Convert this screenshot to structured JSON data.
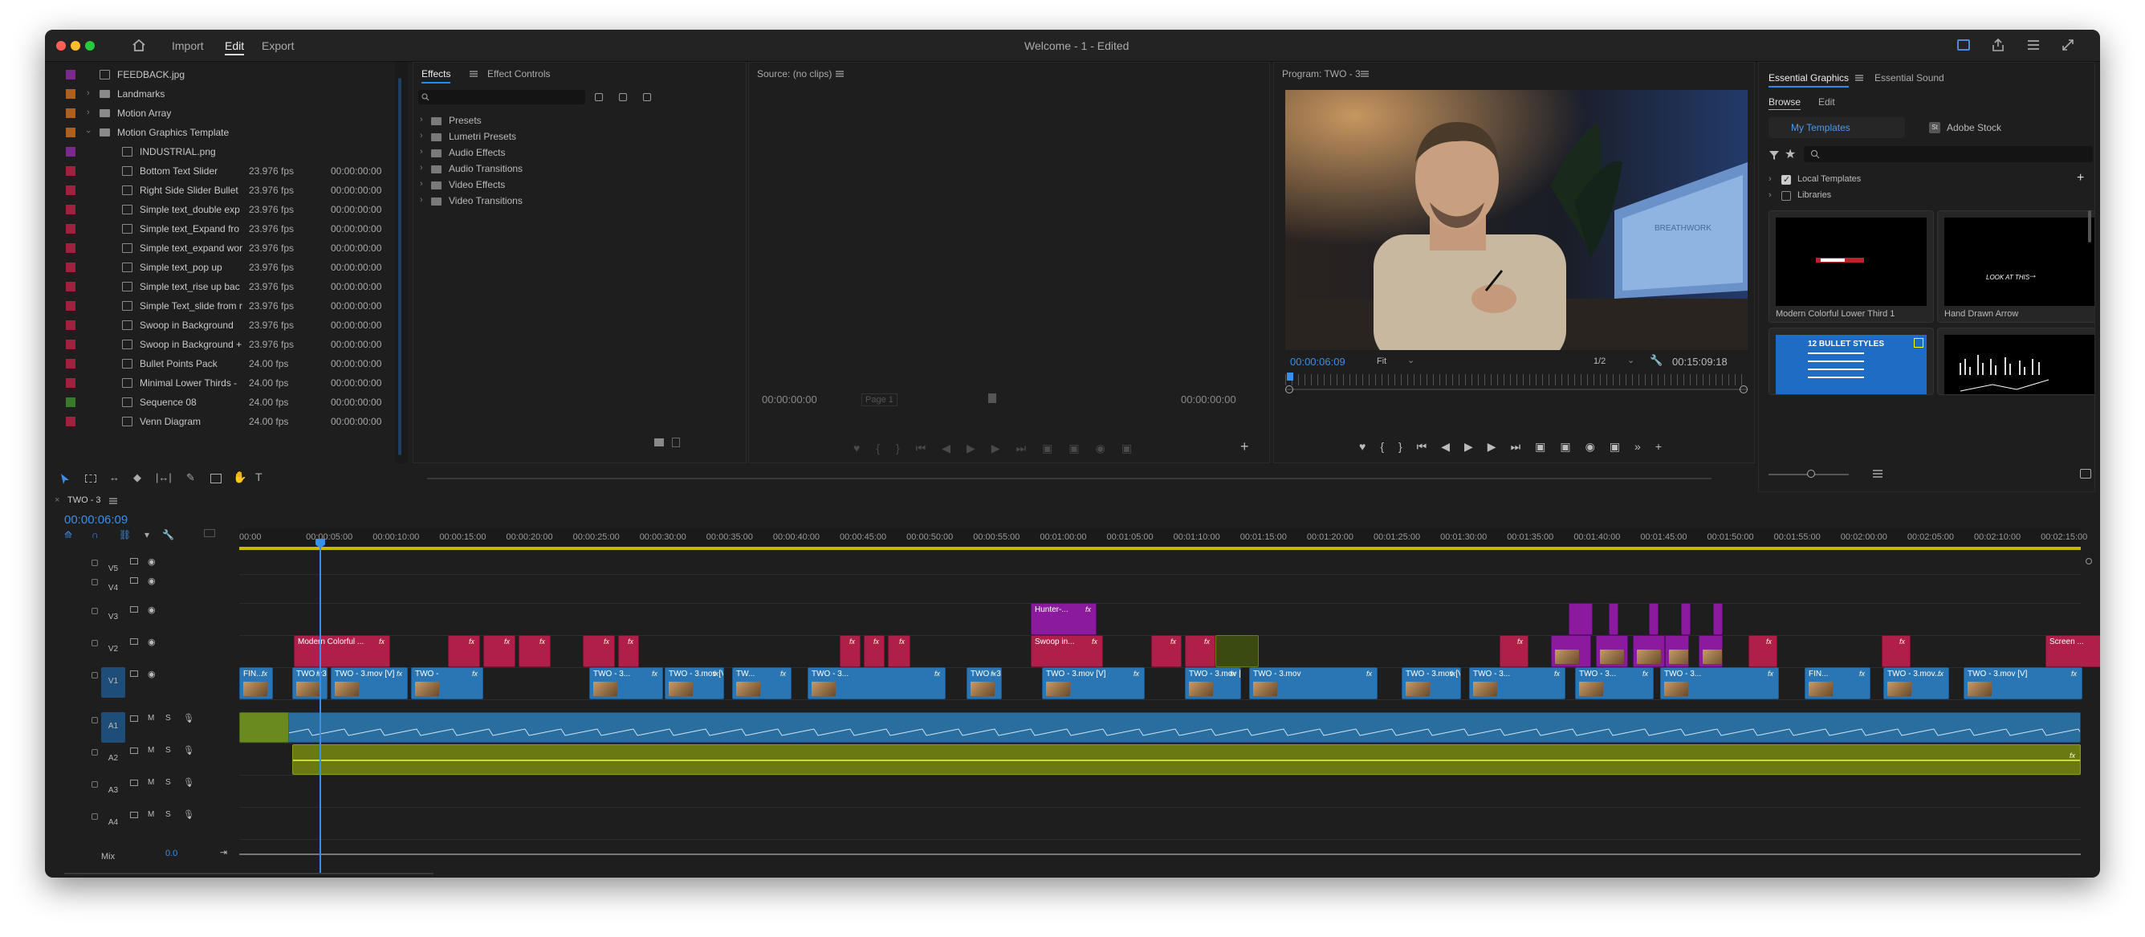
{
  "window": {
    "title": "Welcome - 1 - Edited",
    "menu": [
      "Import",
      "Edit",
      "Export"
    ],
    "active_menu": "Edit"
  },
  "project": {
    "items": [
      {
        "name": "FEEDBACK.jpg",
        "kind": "image",
        "color": "#7a2a8e",
        "fps": "",
        "start": "",
        "indent": 1
      },
      {
        "name": "Landmarks",
        "kind": "folder",
        "color": "#b0601e",
        "fps": "",
        "start": "",
        "indent": 1
      },
      {
        "name": "Motion Array",
        "kind": "folder",
        "color": "#b0601e",
        "fps": "",
        "start": "",
        "indent": 1
      },
      {
        "name": "Motion Graphics Template",
        "kind": "folder",
        "color": "#b0601e",
        "fps": "",
        "start": "",
        "indent": 1,
        "open": true
      },
      {
        "name": "INDUSTRIAL.png",
        "kind": "image",
        "color": "#7a2a8e",
        "fps": "",
        "start": "",
        "indent": 2
      },
      {
        "name": "Bottom Text Slider",
        "kind": "mogrt",
        "color": "#a02040",
        "fps": "23.976 fps",
        "start": "00:00:00:00",
        "indent": 2
      },
      {
        "name": "Right Side Slider Bullet",
        "kind": "mogrt",
        "color": "#a02040",
        "fps": "23.976 fps",
        "start": "00:00:00:00",
        "indent": 2
      },
      {
        "name": "Simple text_double exp",
        "kind": "mogrt",
        "color": "#a02040",
        "fps": "23.976 fps",
        "start": "00:00:00:00",
        "indent": 2
      },
      {
        "name": "Simple text_Expand fro",
        "kind": "mogrt",
        "color": "#a02040",
        "fps": "23.976 fps",
        "start": "00:00:00:00",
        "indent": 2
      },
      {
        "name": "Simple text_expand wor",
        "kind": "mogrt",
        "color": "#a02040",
        "fps": "23.976 fps",
        "start": "00:00:00:00",
        "indent": 2
      },
      {
        "name": "Simple text_pop up",
        "kind": "mogrt",
        "color": "#a02040",
        "fps": "23.976 fps",
        "start": "00:00:00:00",
        "indent": 2
      },
      {
        "name": "Simple text_rise up bac",
        "kind": "mogrt",
        "color": "#a02040",
        "fps": "23.976 fps",
        "start": "00:00:00:00",
        "indent": 2
      },
      {
        "name": "Simple Text_slide from r",
        "kind": "mogrt",
        "color": "#a02040",
        "fps": "23.976 fps",
        "start": "00:00:00:00",
        "indent": 2
      },
      {
        "name": "Swoop in Background",
        "kind": "mogrt",
        "color": "#a02040",
        "fps": "23.976 fps",
        "start": "00:00:00:00",
        "indent": 2
      },
      {
        "name": "Swoop in Background +",
        "kind": "mogrt",
        "color": "#a02040",
        "fps": "23.976 fps",
        "start": "00:00:00:00",
        "indent": 2
      },
      {
        "name": "Bullet Points Pack",
        "kind": "mogrt",
        "color": "#a02040",
        "fps": "24.00 fps",
        "start": "00:00:00:00",
        "indent": 2
      },
      {
        "name": "Minimal Lower Thirds -",
        "kind": "mogrt",
        "color": "#a02040",
        "fps": "24.00 fps",
        "start": "00:00:00:00",
        "indent": 2
      },
      {
        "name": "Sequence 08",
        "kind": "sequence",
        "color": "#3a7a2a",
        "fps": "24.00 fps",
        "start": "00:00:00:00",
        "indent": 2
      },
      {
        "name": "Venn Diagram",
        "kind": "mogrt",
        "color": "#a02040",
        "fps": "24.00 fps",
        "start": "00:00:00:00",
        "indent": 2
      }
    ]
  },
  "effects": {
    "tabs": [
      "Effects",
      "Effect Controls"
    ],
    "active_tab": "Effects",
    "folders": [
      "Presets",
      "Lumetri Presets",
      "Audio Effects",
      "Audio Transitions",
      "Video Effects",
      "Video Transitions"
    ]
  },
  "source": {
    "title": "Source: (no clips)",
    "timecode_left": "00:00:00:00",
    "timecode_right": "00:00:00:00",
    "page": "Page 1"
  },
  "program": {
    "title": "Program: TWO - 3",
    "timecode": "00:00:06:09",
    "fit": "Fit",
    "resolution": "1/2",
    "duration": "00:15:09:18",
    "frame_text": "BREATHWORK"
  },
  "essential_graphics": {
    "tabs": [
      "Essential Graphics",
      "Essential Sound"
    ],
    "subtabs": [
      "Browse",
      "Edit"
    ],
    "sources": [
      "My Templates",
      "Adobe Stock"
    ],
    "tree": [
      "Local Templates",
      "Libraries"
    ],
    "templates": [
      {
        "name": "Modern Colorful Lower Third 1"
      },
      {
        "name": "Hand Drawn Arrow",
        "thumb_text": "LOOK AT THIS"
      },
      {
        "name": "",
        "thumb_text": "12 BULLET STYLES"
      },
      {
        "name": ""
      }
    ]
  },
  "timeline": {
    "sequence": "TWO - 3",
    "timecode": "00:00:06:09",
    "ruler": [
      "00:00",
      "00:00:05:00",
      "00:00:10:00",
      "00:00:15:00",
      "00:00:20:00",
      "00:00:25:00",
      "00:00:30:00",
      "00:00:35:00",
      "00:00:40:00",
      "00:00:45:00",
      "00:00:50:00",
      "00:00:55:00",
      "00:01:00:00",
      "00:01:05:00",
      "00:01:10:00",
      "00:01:15:00",
      "00:01:20:00",
      "00:01:25:00",
      "00:01:30:00",
      "00:01:35:00",
      "00:01:40:00",
      "00:01:45:00",
      "00:01:50:00",
      "00:01:55:00",
      "00:02:00:00",
      "00:02:05:00",
      "00:02:10:00",
      "00:02:15:00"
    ],
    "video_tracks": [
      "V5",
      "V4",
      "V3",
      "V2",
      "V1"
    ],
    "audio_tracks": [
      "A1",
      "A2",
      "A3",
      "A4"
    ],
    "mix_label": "Mix",
    "mix_value": "0.0",
    "clips_v1": [
      "FIN...",
      "TWO - 3.mov...",
      "TWO - 3.mov [V]",
      "TWO -",
      "TWO - 3...",
      "TWO - 3.mov [V]",
      "TW...",
      "TWO - 3...",
      "TWO - 3.mov [V]",
      "TWO - 3.mov [V]",
      "TWO - 3.mov [V]",
      "TWO - 3.mov",
      "TWO - 3.mov [V]",
      "TWO - 3...",
      "TWO - 3...",
      "TWO - 3..."
    ],
    "clips_v2": [
      "Modern Colorful ...",
      "Swoop in...",
      "Screen ..."
    ],
    "clips_v3": [
      "Hunter-..."
    ],
    "fx": "fx"
  }
}
